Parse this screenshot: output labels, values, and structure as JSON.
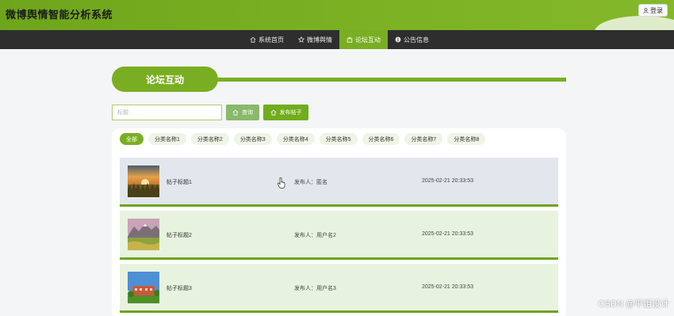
{
  "header": {
    "site_title": "微博舆情智能分析系统",
    "login_label": "登录"
  },
  "nav": {
    "items": [
      {
        "label": "系统首页",
        "icon": "home-icon"
      },
      {
        "label": "微博舆情",
        "icon": "star-icon"
      },
      {
        "label": "论坛互动",
        "icon": "bag-icon",
        "active": true
      },
      {
        "label": "公告信息",
        "icon": "info-icon"
      }
    ]
  },
  "section": {
    "title": "论坛互动"
  },
  "search": {
    "placeholder": "标题",
    "query_label": "查询",
    "post_label": "发布帖子"
  },
  "categories": [
    "全部",
    "分类名称1",
    "分类名称2",
    "分类名称3",
    "分类名称4",
    "分类名称5",
    "分类名称6",
    "分类名称7",
    "分类名称8"
  ],
  "posts": [
    {
      "title": "帖子标题1",
      "author_label": "发布人：",
      "author": "匿名",
      "time": "2025-02-21 20:33:53"
    },
    {
      "title": "帖子标题2",
      "author_label": "发布人：",
      "author": "用户名2",
      "time": "2025-02-21 20:33:53"
    },
    {
      "title": "帖子标题3",
      "author_label": "发布人：",
      "author": "用户名3",
      "time": "2025-02-21 20:33:53"
    }
  ],
  "watermark": "CSDN @平姐设计",
  "colors": {
    "accent": "#7aae22",
    "nav_bg": "#2e2e2e",
    "post_bg": "#e8f3df",
    "post_hover_bg": "#e2e6ed"
  }
}
